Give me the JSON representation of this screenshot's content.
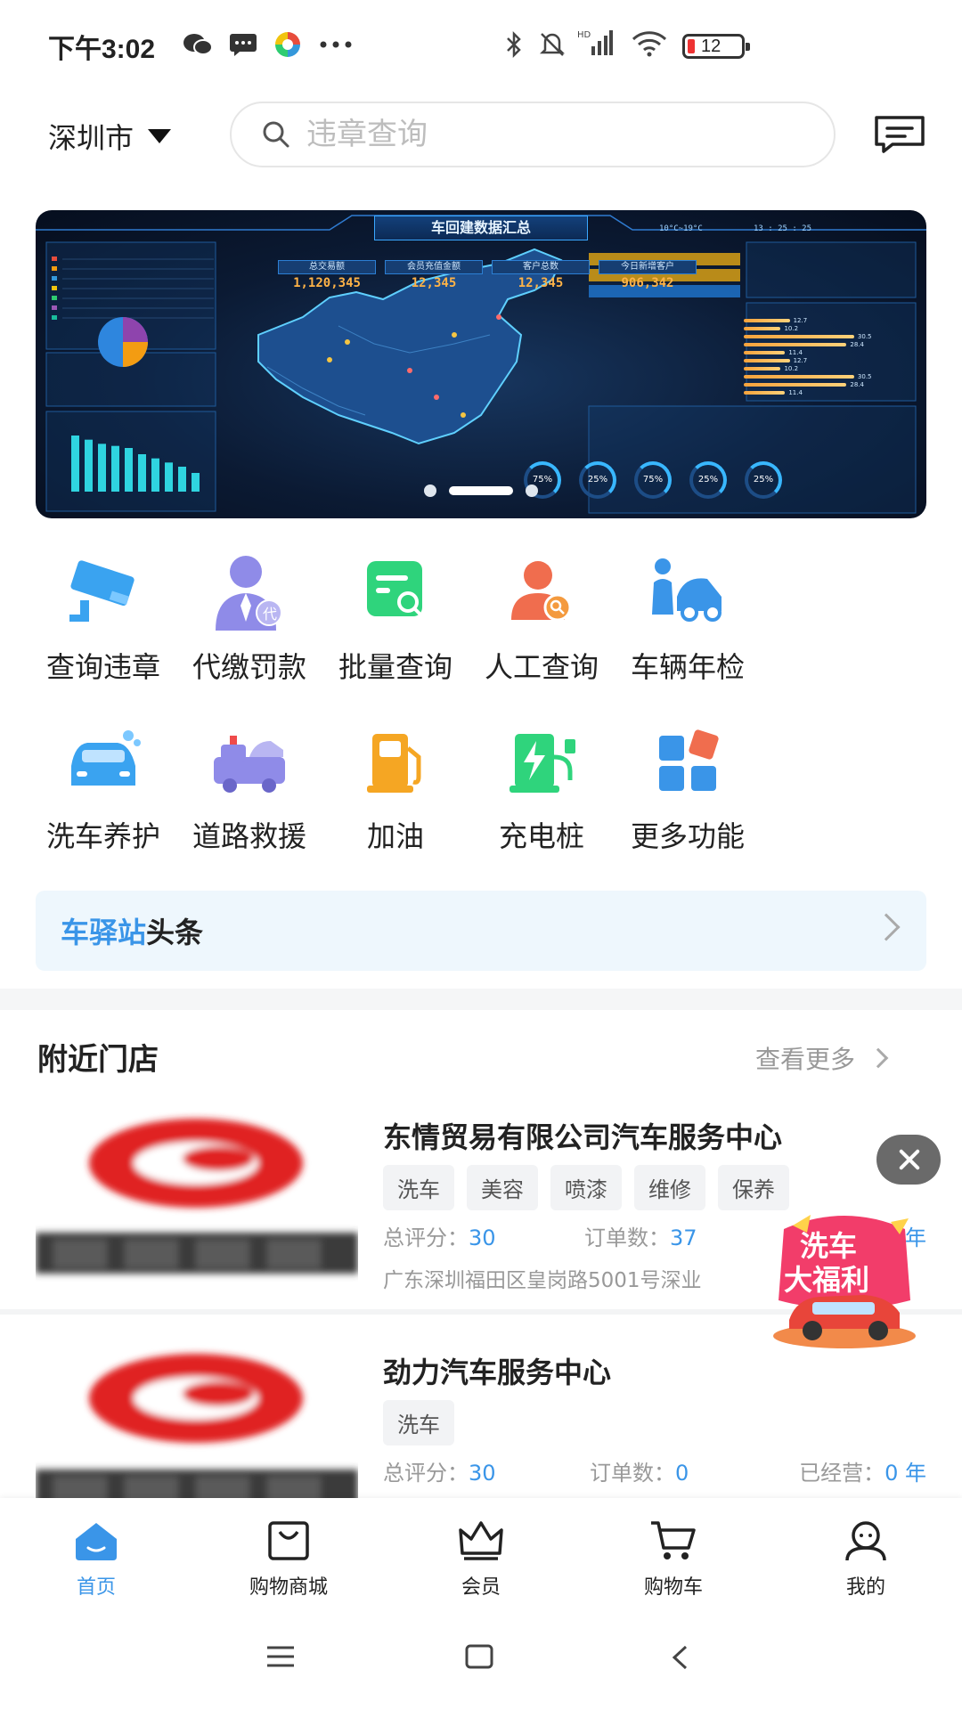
{
  "status_bar": {
    "time": "下午3:02",
    "battery": "12"
  },
  "header": {
    "city": "深圳市",
    "search_placeholder": "违章查询"
  },
  "banner": {
    "title": "车回建数据汇总",
    "weather": "10°C~19°C",
    "clock": "13 : 25 : 25",
    "kpis": [
      {
        "label": "总交易额",
        "value": "1,120,345"
      },
      {
        "label": "会员充值金额",
        "value": "12,345"
      },
      {
        "label": "客户总数",
        "value": "12,345"
      },
      {
        "label": "今日新增客户",
        "value": "906,342"
      }
    ],
    "bar_values": [
      270,
      250,
      230,
      220,
      210,
      180,
      160,
      140,
      120,
      90
    ],
    "hbar_values": [
      12.7,
      10.2,
      30.5,
      28.4,
      11.4,
      12.7,
      10.2,
      30.5,
      28.4,
      11.4
    ],
    "gauges": [
      "75%",
      "25%",
      "75%",
      "25%",
      "25%"
    ],
    "page_index": 1,
    "page_count": 3
  },
  "grid": [
    {
      "label": "查询违章",
      "icon": "camera-icon"
    },
    {
      "label": "代缴罚款",
      "icon": "agent-icon"
    },
    {
      "label": "批量查询",
      "icon": "batch-query-icon"
    },
    {
      "label": "人工查询",
      "icon": "manual-query-icon"
    },
    {
      "label": "车辆年检",
      "icon": "car-inspection-icon"
    },
    {
      "label": "洗车养护",
      "icon": "car-wash-icon"
    },
    {
      "label": "道路救援",
      "icon": "tow-truck-icon"
    },
    {
      "label": "加油",
      "icon": "fuel-pump-icon"
    },
    {
      "label": "充电桩",
      "icon": "charger-icon"
    },
    {
      "label": "更多功能",
      "icon": "more-apps-icon"
    }
  ],
  "headline": {
    "brand": "车驿站",
    "suffix": "头条"
  },
  "nearby": {
    "title": "附近门店",
    "see_more": "查看更多",
    "stores": [
      {
        "name": "东情贸易有限公司汽车服务中心",
        "tags": [
          "洗车",
          "美容",
          "喷漆",
          "维修",
          "保养"
        ],
        "score_label": "总评分：",
        "score": "30",
        "orders_label": "订单数：",
        "orders": "37",
        "years_label": "",
        "years": "年",
        "address": "广东深圳福田区皇岗路5001号深业"
      },
      {
        "name": "劲力汽车服务中心",
        "tags": [
          "洗车"
        ],
        "score_label": "总评分：",
        "score": "30",
        "orders_label": "订单数：",
        "orders": "0",
        "years_label": "已经营：",
        "years": "0 年",
        "address": ""
      }
    ]
  },
  "promo": {
    "line1": "洗车",
    "line2": "大福利"
  },
  "tabs": [
    {
      "label": "首页",
      "icon": "home-icon",
      "active": true
    },
    {
      "label": "购物商城",
      "icon": "shopping-bag-icon",
      "active": false
    },
    {
      "label": "会员",
      "icon": "crown-icon",
      "active": false
    },
    {
      "label": "购物车",
      "icon": "cart-icon",
      "active": false
    },
    {
      "label": "我的",
      "icon": "profile-icon",
      "active": false
    }
  ],
  "colors": {
    "accent": "#3a95e8",
    "headline_bg": "#eef7fd"
  }
}
